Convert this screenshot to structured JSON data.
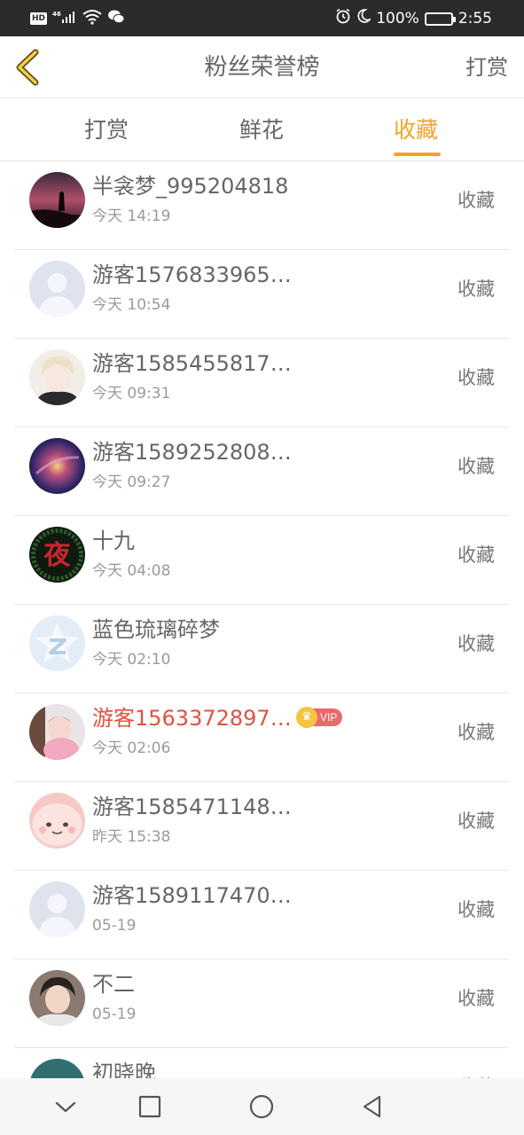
{
  "status_bar": {
    "hd": "HD",
    "network": "46",
    "battery": "100%",
    "time": "2:55"
  },
  "header": {
    "title": "粉丝荣誉榜",
    "action": "打赏"
  },
  "tabs": [
    {
      "label": "打赏",
      "active": false
    },
    {
      "label": "鲜花",
      "active": false
    },
    {
      "label": "收藏",
      "active": true
    }
  ],
  "accent_color": "#f3a32a",
  "vip_name_color": "#e0533f",
  "fans": [
    {
      "name": "半衾梦_995204818",
      "time": "今天 14:19",
      "action": "收藏",
      "vip": false,
      "avatar": "photo-avatar"
    },
    {
      "name": "游客1576833965…",
      "time": "今天 10:54",
      "action": "收藏",
      "vip": false,
      "avatar": "default-avatar"
    },
    {
      "name": "游客1585455817…",
      "time": "今天 09:31",
      "action": "收藏",
      "vip": false,
      "avatar": "photo-avatar"
    },
    {
      "name": "游客1589252808…",
      "time": "今天 09:27",
      "action": "收藏",
      "vip": false,
      "avatar": "photo-avatar"
    },
    {
      "name": "十九",
      "time": "今天 04:08",
      "action": "收藏",
      "vip": false,
      "avatar": "photo-avatar",
      "avatar_glyph": "夜"
    },
    {
      "name": "蓝色琉璃碎梦",
      "time": "今天 02:10",
      "action": "收藏",
      "vip": false,
      "avatar": "qzone-avatar"
    },
    {
      "name": "游客1563372897…",
      "time": "今天 02:06",
      "action": "收藏",
      "vip": true,
      "vip_label": "VIP",
      "avatar": "photo-avatar"
    },
    {
      "name": "游客1585471148…",
      "time": "昨天 15:38",
      "action": "收藏",
      "vip": false,
      "avatar": "cartoon-avatar"
    },
    {
      "name": "游客1589117470…",
      "time": "05-19",
      "action": "收藏",
      "vip": false,
      "avatar": "default-avatar"
    },
    {
      "name": "不二",
      "time": "05-19",
      "action": "收藏",
      "vip": false,
      "avatar": "photo-avatar"
    },
    {
      "name": "初晓晚",
      "time": "",
      "action": "收藏",
      "vip": false,
      "avatar": "photo-avatar"
    }
  ],
  "nav": [
    "collapse-icon",
    "recent-apps-icon",
    "home-icon",
    "back-icon"
  ]
}
